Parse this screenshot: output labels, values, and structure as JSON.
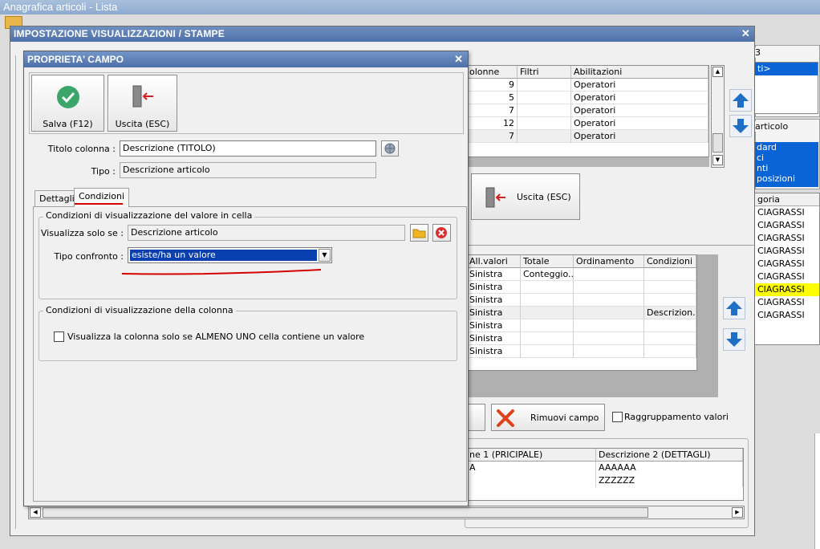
{
  "app": {
    "title": "Anagrafica articoli  - Lista"
  },
  "background": {
    "top_right_label": "3",
    "list1": [
      {
        "text": "ti>",
        "selected": true
      }
    ],
    "group2_label": "articolo",
    "list2": [
      {
        "text": "dard",
        "selected": true
      },
      {
        "text": "ci",
        "selected": true
      },
      {
        "text": "nti",
        "selected": true
      },
      {
        "text": "posizioni",
        "selected": true
      }
    ],
    "category_header": "goria",
    "category_rows": [
      "CIAGRASSI",
      "CIAGRASSI",
      "CIAGRASSI",
      "CIAGRASSI",
      "CIAGRASSI",
      "CIAGRASSI",
      "CIAGRASSI",
      "CIAGRASSI",
      "CIAGRASSI"
    ],
    "category_highlight_index": 6
  },
  "imp_dialog": {
    "title": "IMPOSTAZIONE VISUALIZZAZIONI / STAMPE",
    "close": "✕",
    "top_grid": {
      "headers": [
        "olonne",
        "Filtri",
        "Abilitazioni"
      ],
      "rows": [
        [
          "9",
          "",
          "Operatori"
        ],
        [
          "5",
          "",
          "Operatori"
        ],
        [
          "7",
          "",
          "Operatori"
        ],
        [
          "12",
          "",
          "Operatori"
        ],
        [
          "7",
          "",
          "Operatori"
        ]
      ]
    },
    "exit_button": "Uscita (ESC)",
    "fields_grid": {
      "headers": [
        "All.valori",
        "Totale",
        "Ordinamento",
        "Condizioni"
      ],
      "rows": [
        [
          "Sinistra",
          "Conteggio...",
          "",
          ""
        ],
        [
          "Sinistra",
          "",
          "",
          ""
        ],
        [
          "Sinistra",
          "",
          "",
          ""
        ],
        [
          "Sinistra",
          "",
          "",
          "Descrizion..."
        ],
        [
          "Sinistra",
          "",
          "",
          ""
        ],
        [
          "Sinistra",
          "",
          "",
          ""
        ],
        [
          "Sinistra",
          "",
          "",
          ""
        ]
      ]
    },
    "remove_field_button": "Rimuovi campo",
    "grouping_checkbox": "Raggruppamento valori",
    "desc_grid": {
      "headers": [
        "ne 1 (PRICIPALE)",
        "Descrizione 2 (DETTAGLI)"
      ],
      "rows": [
        [
          "A",
          "AAAAAA"
        ],
        [
          "",
          "ZZZZZZ"
        ]
      ]
    }
  },
  "prop_dialog": {
    "title": "PROPRIETA' CAMPO",
    "close": "✕",
    "save_button": "Salva (F12)",
    "exit_button": "Uscita (ESC)",
    "column_title_label": "Titolo colonna :",
    "column_title_value": "Descrizione (TITOLO)",
    "type_label": "Tipo :",
    "type_value": "Descrizione articolo",
    "tabs": [
      "Dettagli",
      "Condizioni"
    ],
    "active_tab": "Condizioni",
    "cell_group_title": "Condizioni di visualizzazione del valore in cella",
    "show_only_if_label": "Visualizza solo se :",
    "show_only_if_value": "Descrizione articolo",
    "compare_type_label": "Tipo confronto :",
    "compare_type_value": "esiste/ha un valore",
    "column_group_title": "Condizioni di visualizzazione della colonna",
    "column_checkbox_label": "Visualizza la colonna solo se ALMENO UNO cella contiene un valore",
    "colors": {
      "accent_red": "#d40000",
      "save_green": "#3aa66a",
      "selection_blue": "#0a3fb0"
    }
  }
}
